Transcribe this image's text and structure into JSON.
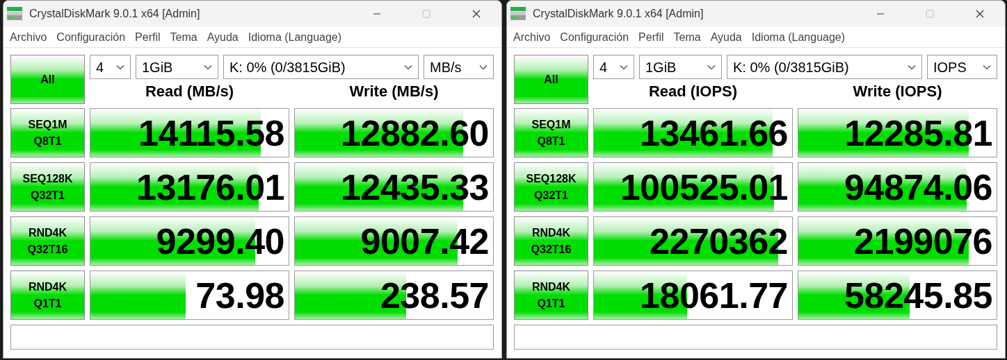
{
  "windows": [
    {
      "title": "CrystalDiskMark 9.0.1 x64 [Admin]",
      "menu": [
        "Archivo",
        "Configuración",
        "Perfil",
        "Tema",
        "Ayuda",
        "Idioma (Language)"
      ],
      "all_button": "All",
      "selectors": [
        "4",
        "1GiB",
        "K: 0% (0/3815GiB)",
        "MB/s"
      ],
      "headers": [
        "Read (MB/s)",
        "Write (MB/s)"
      ],
      "rows": [
        {
          "test": "SEQ1M",
          "params": "Q8T1",
          "read": {
            "value": "14115.58",
            "level": 0.86
          },
          "write": {
            "value": "12882.60",
            "level": 0.85
          }
        },
        {
          "test": "SEQ128K",
          "params": "Q32T1",
          "read": {
            "value": "13176.01",
            "level": 0.85
          },
          "write": {
            "value": "12435.33",
            "level": 0.85
          }
        },
        {
          "test": "RND4K",
          "params": "Q32T16",
          "read": {
            "value": "9299.40",
            "level": 0.83
          },
          "write": {
            "value": "9007.42",
            "level": 0.82
          }
        },
        {
          "test": "RND4K",
          "params": "Q1T1",
          "read": {
            "value": "73.98",
            "level": 0.48
          },
          "write": {
            "value": "238.57",
            "level": 0.56
          }
        }
      ]
    },
    {
      "title": "CrystalDiskMark 9.0.1 x64 [Admin]",
      "menu": [
        "Archivo",
        "Configuración",
        "Perfil",
        "Tema",
        "Ayuda",
        "Idioma (Language)"
      ],
      "all_button": "All",
      "selectors": [
        "4",
        "1GiB",
        "K: 0% (0/3815GiB)",
        "IOPS"
      ],
      "headers": [
        "Read (IOPS)",
        "Write (IOPS)"
      ],
      "rows": [
        {
          "test": "SEQ1M",
          "params": "Q8T1",
          "read": {
            "value": "13461.66",
            "level": 0.9
          },
          "write": {
            "value": "12285.81",
            "level": 0.86
          }
        },
        {
          "test": "SEQ128K",
          "params": "Q32T1",
          "read": {
            "value": "100525.01",
            "level": 0.91
          },
          "write": {
            "value": "94874.06",
            "level": 0.85
          }
        },
        {
          "test": "RND4K",
          "params": "Q32T16",
          "read": {
            "value": "2270362",
            "level": 0.93
          },
          "write": {
            "value": "2199076",
            "level": 0.86
          }
        },
        {
          "test": "RND4K",
          "params": "Q1T1",
          "read": {
            "value": "18061.77",
            "level": 0.47
          },
          "write": {
            "value": "58245.85",
            "level": 0.56
          }
        }
      ]
    }
  ]
}
